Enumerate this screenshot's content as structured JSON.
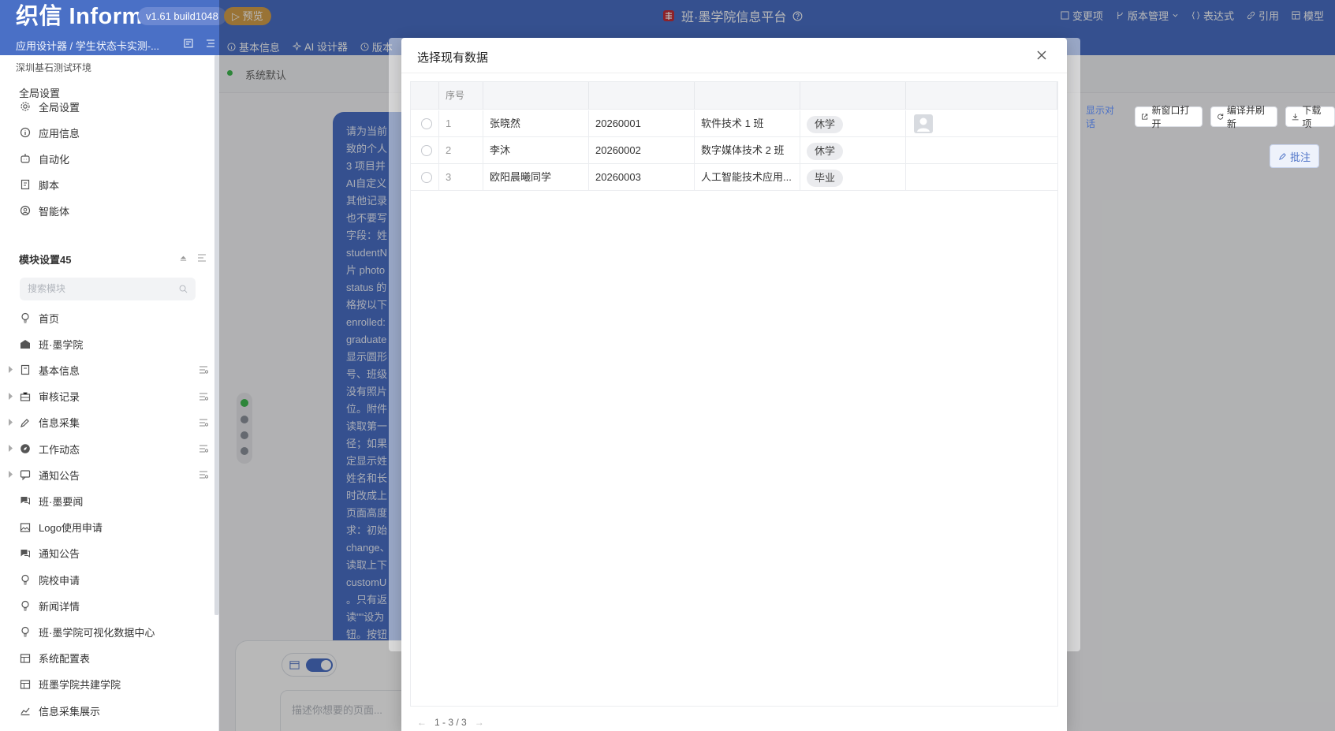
{
  "header": {
    "logo": "织信 Informat",
    "version": "v1.61 build1048",
    "preview_label": "▷ 预览",
    "app_title": "班·墨学院信息平台",
    "menu": [
      "变更项",
      "版本管理",
      "表达式",
      "引用",
      "模型"
    ],
    "breadcrumb": "应用设计器 / 学生状态卡实测-...",
    "tabs": [
      "基本信息",
      "AI 设计器",
      "版本"
    ]
  },
  "sidebar": {
    "env": "深圳基石测试环境",
    "global_section": "全局设置",
    "global_items": [
      "全局设置",
      "应用信息",
      "自动化",
      "脚本",
      "智能体"
    ],
    "module_section": "模块设置45",
    "search_placeholder": "搜索模块",
    "modules": [
      {
        "label": "首页",
        "icon": "bulb-icon",
        "expandable": false
      },
      {
        "label": "班·墨学院",
        "icon": "school-icon",
        "expandable": false
      },
      {
        "label": "基本信息",
        "icon": "doc-icon",
        "expandable": true
      },
      {
        "label": "审核记录",
        "icon": "briefcase-icon",
        "expandable": true
      },
      {
        "label": "信息采集",
        "icon": "pencil-icon",
        "expandable": true
      },
      {
        "label": "工作动态",
        "icon": "compass-icon",
        "expandable": true
      },
      {
        "label": "通知公告",
        "icon": "message-icon",
        "expandable": true
      },
      {
        "label": "班·墨要闻",
        "icon": "chat-icon",
        "expandable": false
      },
      {
        "label": "Logo使用申请",
        "icon": "image-icon",
        "expandable": false
      },
      {
        "label": "通知公告",
        "icon": "chat-icon",
        "expandable": false
      },
      {
        "label": "院校申请",
        "icon": "bulb-icon",
        "expandable": false
      },
      {
        "label": "新闻详情",
        "icon": "bulb-icon",
        "expandable": false
      },
      {
        "label": "班·墨学院可视化数据中心",
        "icon": "bulb-icon",
        "expandable": false
      },
      {
        "label": "系统配置表",
        "icon": "table-icon",
        "expandable": false
      },
      {
        "label": "班墨学院共建学院",
        "icon": "table-icon",
        "expandable": false
      },
      {
        "label": "信息采集展示",
        "icon": "chart-icon",
        "expandable": false
      }
    ]
  },
  "main": {
    "status_label": "系统默认",
    "chat_lines": [
      "请为当前",
      "致的个人",
      "3 项目并",
      "AI自定义",
      "其他记录",
      "也不要写",
      "字段：姓",
      "studentN",
      "片 photo",
      "status 的",
      "格按以下",
      "enrolled:",
      "graduate",
      "显示圆形",
      "号、班级",
      "没有照片",
      "位。附件",
      "读取第一",
      "径；如果",
      "定显示姓",
      "姓名和长",
      "时改成上",
      "页面高度",
      "求：初始",
      "change、",
      "读取上下",
      "customU",
      "。只有返",
      "读\"\"设为",
      "钮。按钮"
    ],
    "composer_placeholder": "描述你想要的页面...",
    "right_actions": [
      "显示对话",
      "新窗口打开",
      "编译并刷新",
      "下载项"
    ],
    "annotate_label": "批注"
  },
  "dialog": {
    "title": "选择现有数据",
    "columns": [
      "序号",
      "",
      "",
      "",
      "",
      ""
    ],
    "rows": [
      {
        "index": "1",
        "name": "张晓然",
        "id": "20260001",
        "class": "软件技术 1 班",
        "status": "休学",
        "has_photo": true
      },
      {
        "index": "2",
        "name": "李沐",
        "id": "20260002",
        "class": "数字媒体技术 2 班",
        "status": "休学",
        "has_photo": false
      },
      {
        "index": "3",
        "name": "欧阳晨曦同学",
        "id": "20260003",
        "class": "人工智能技术应用...",
        "status": "毕业",
        "has_photo": false
      }
    ],
    "pager": "1 - 3 / 3"
  },
  "colors": {
    "brand": "#4a70c6",
    "preview": "#d5a04a",
    "status_dot": "#3fb950"
  }
}
